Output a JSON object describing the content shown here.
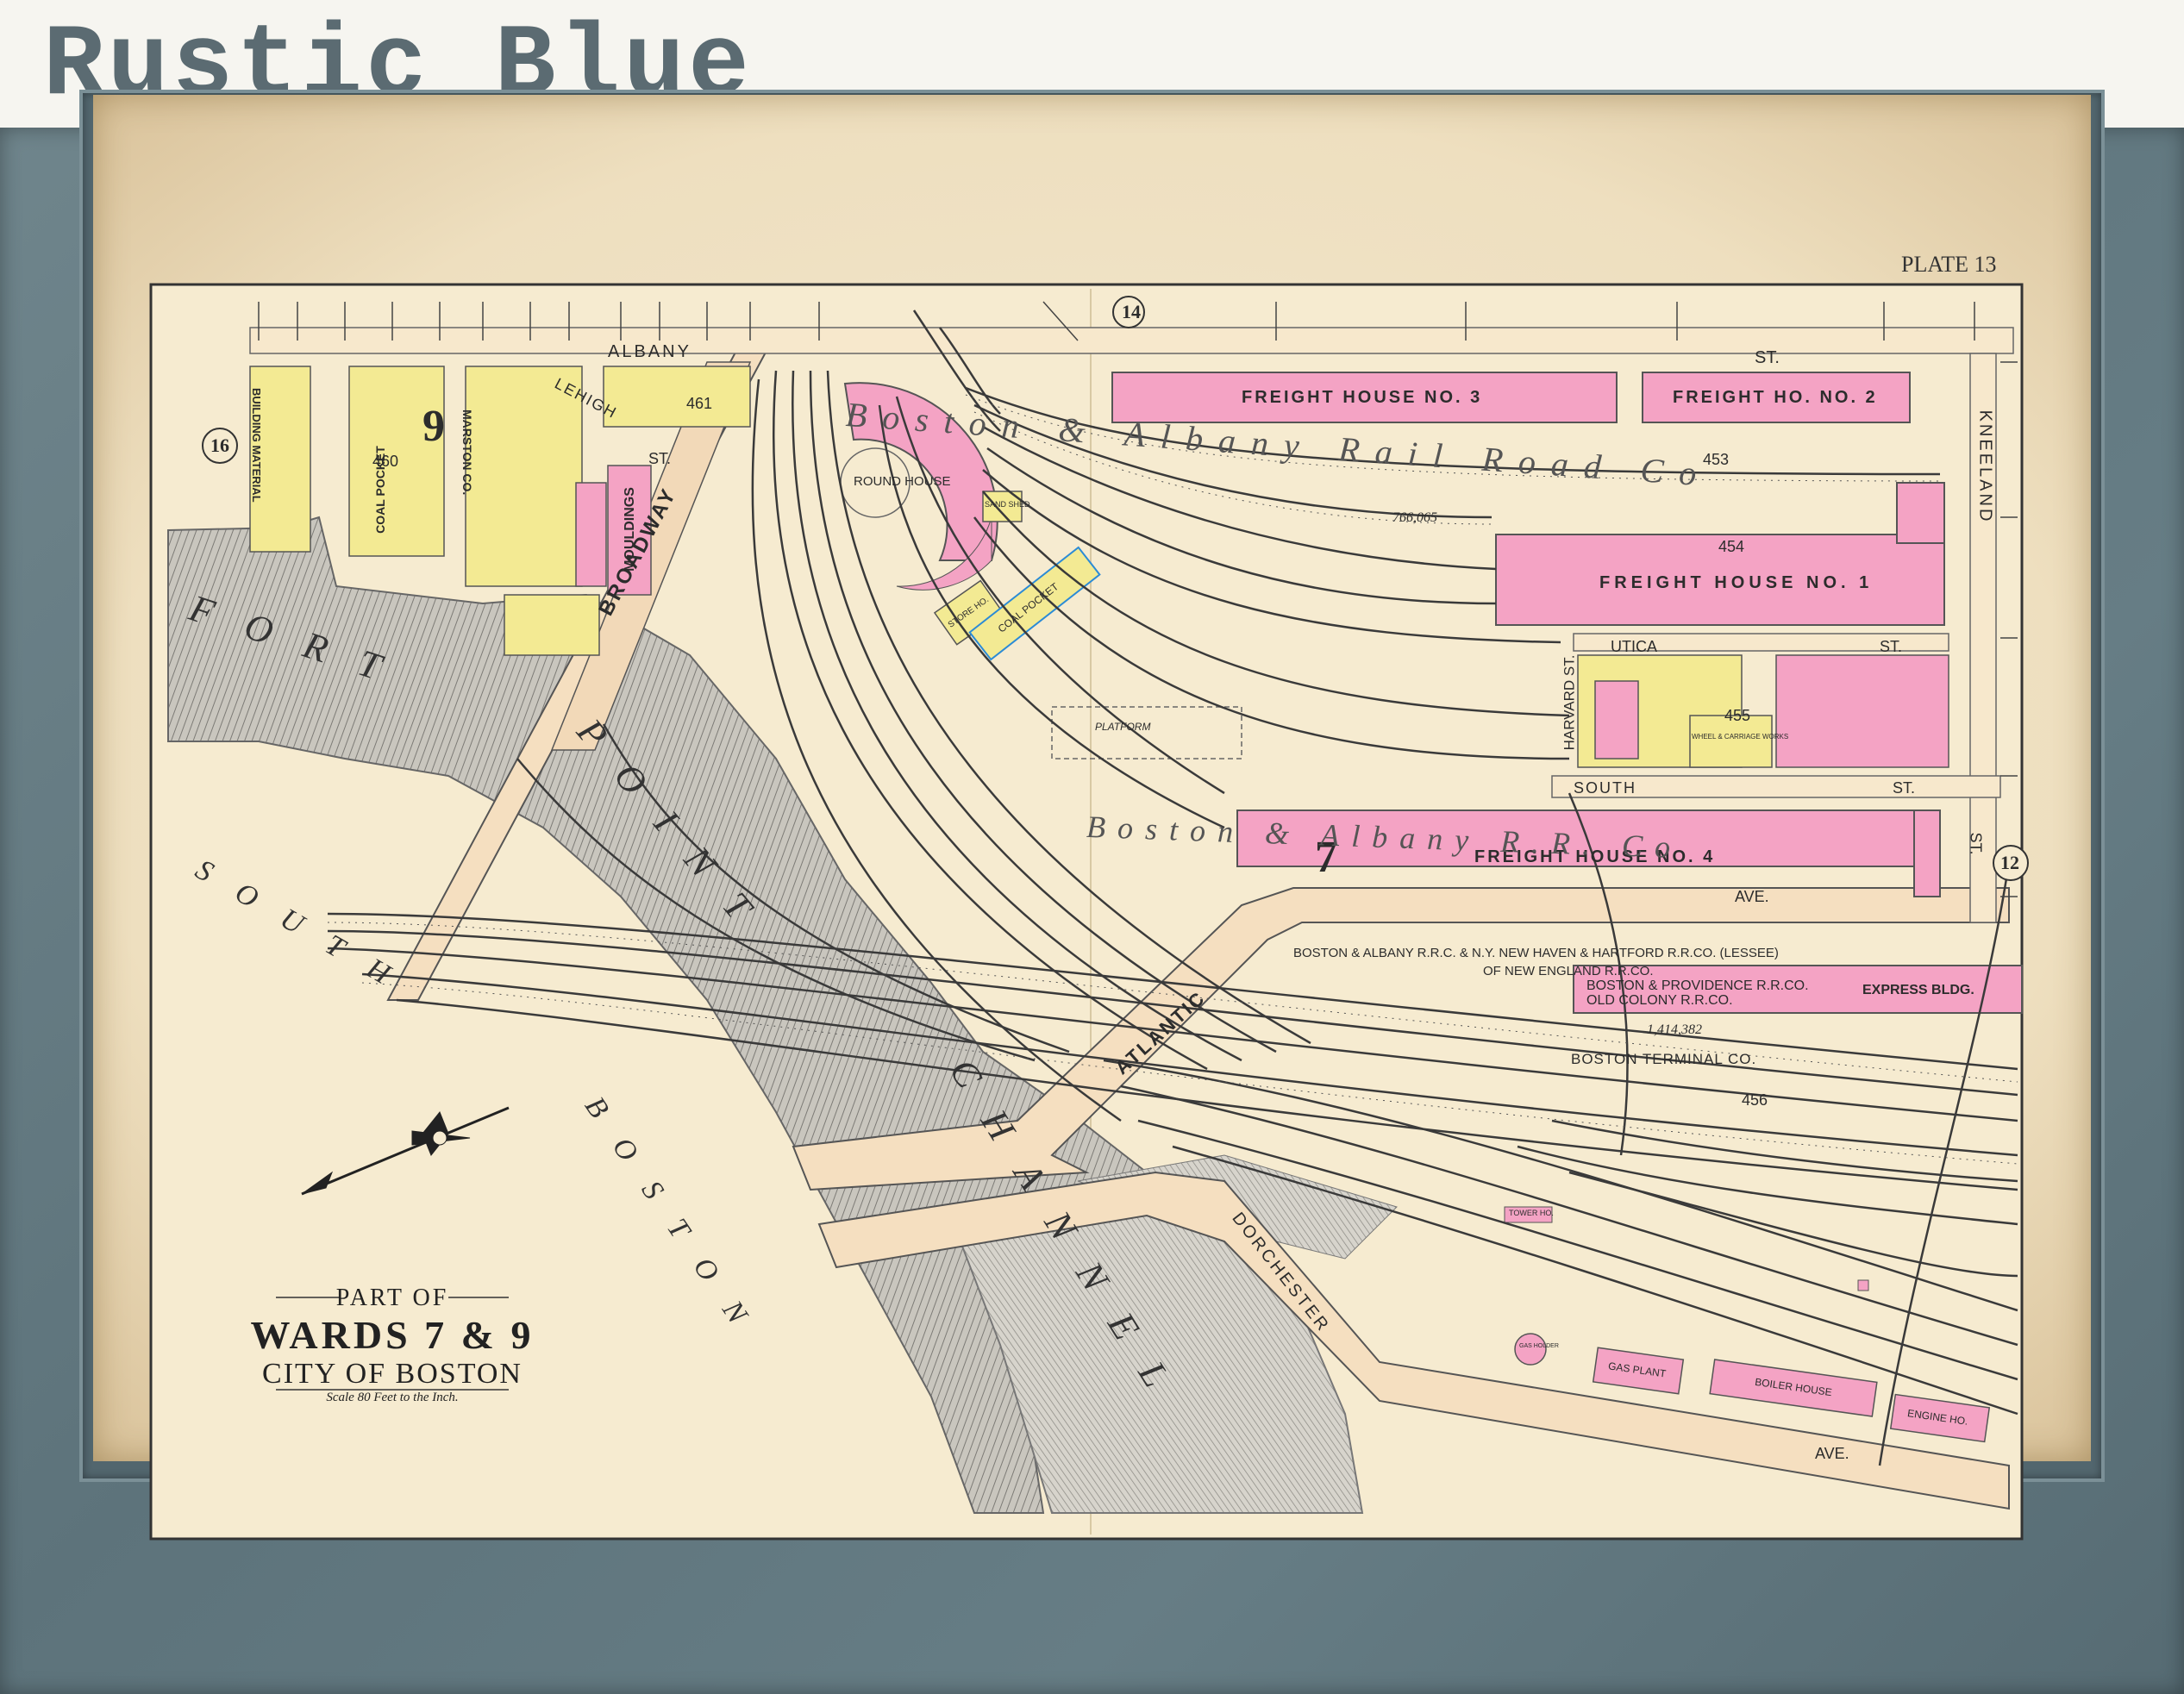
{
  "brand": {
    "title": "Rustic Blue"
  },
  "map": {
    "plate": "PLATE 13",
    "title": {
      "line1": "PART OF",
      "line2": "WARDS 7 & 9",
      "line3": "CITY OF BOSTON",
      "scale": "Scale 80 Feet to the Inch."
    },
    "ward_circles": [
      "14",
      "16",
      "12"
    ],
    "ward_numbers": [
      "9",
      "7"
    ],
    "lot_numbers": [
      "460",
      "461",
      "453",
      "454",
      "455",
      "456"
    ],
    "areas": [
      "766,065",
      "1,414,382"
    ],
    "streets": {
      "albany": "ALBANY",
      "st1": "ST.",
      "lehigh": "LEHIGH",
      "st2": "ST.",
      "broadway": "BROADWAY",
      "utica": "UTICA",
      "st3": "ST.",
      "south": "SOUTH",
      "st4": "ST.",
      "harvard": "HARVARD ST.",
      "kneeland": "KNEELAND",
      "st5": "ST.",
      "ave1": "AVE.",
      "atlantic": "ATLANTIC",
      "dorchester": "DORCHESTER",
      "ave2": "AVE."
    },
    "buildings": {
      "fh3": "FREIGHT HOUSE NO. 3",
      "fh2": "FREIGHT HO. NO. 2",
      "fh1": "FREIGHT HOUSE NO. 1",
      "fh4": "FREIGHT HOUSE NO. 4",
      "roundhouse": "ROUND HOUSE",
      "sandshed": "SAND SHED",
      "store": "STORE HO.",
      "coalpocket": "COAL POCKET",
      "coalpocket2": "COAL POCKET",
      "mouldings": "MOULDINGS",
      "platform": "PLATFORM",
      "express": "EXPRESS BLDG.",
      "tower": "TOWER HO.",
      "gasholder": "GAS HOLDER",
      "gasplant": "GAS PLANT",
      "boilerhouse": "BOILER HOUSE",
      "enginehouse": "ENGINE HO.",
      "wheel": "WHEEL & CARRIAGE WORKS"
    },
    "companies": {
      "ba_rr": "Boston & Albany Rail Road Co",
      "ba_rr2": "Boston & Albany R.R. Co",
      "terminal1": "BOSTON & ALBANY R.R.C. & N.Y. NEW HAVEN & HARTFORD R.R.CO. (LESSEE)",
      "terminal2": "OF NEW ENGLAND R.R.CO.",
      "terminal3": "BOSTON & PROVIDENCE R.R.CO.",
      "terminal4": "OLD COLONY R.R.CO.",
      "terminal5": "BOSTON TERMINAL CO.",
      "marston": "MARSTON CO.",
      "building_material": "BUILDING MATERIAL"
    },
    "water": {
      "fort": "FORT",
      "point": "POINT",
      "channel": "CHANNEL",
      "south": "SOUTH",
      "boston": "BOSTON"
    }
  },
  "colors": {
    "frame": "#617880",
    "mat": "#efe2c4",
    "paper": "#f6ebd0",
    "pink": "#f4a3c4",
    "yellow": "#f3ea93",
    "road": "#f5dfc0",
    "water_hatch": "#9a9a9a"
  }
}
